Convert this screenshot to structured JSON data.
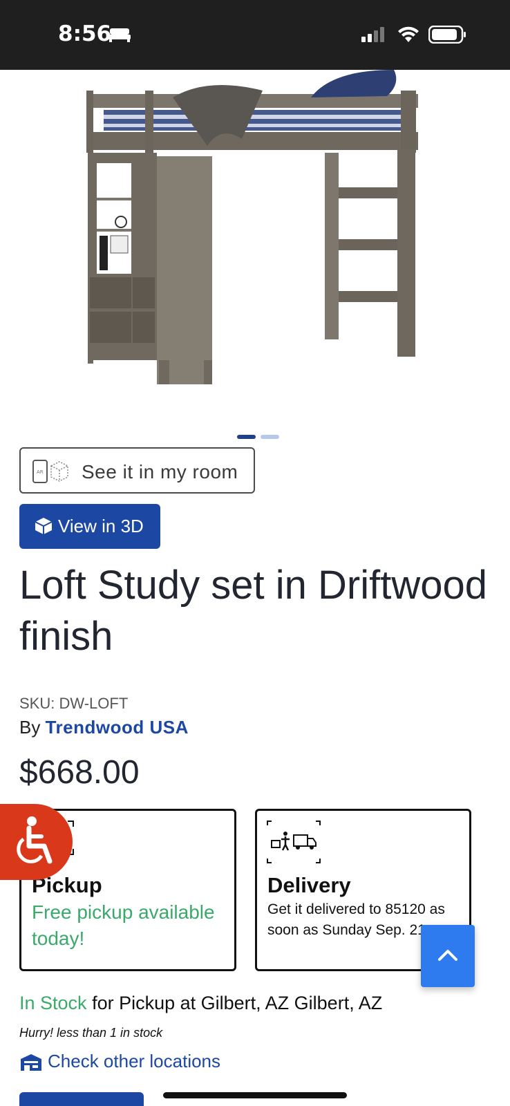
{
  "status_bar": {
    "time": "8:56",
    "icons": [
      "bed-icon",
      "signal-icon",
      "wifi-icon",
      "battery-icon"
    ]
  },
  "product": {
    "image_alt": "Loft bed with storage cabinet in driftwood finish",
    "carousel": {
      "total": 2,
      "active": 1
    },
    "ar_button_label": "See it in my room",
    "view3d_label": "View in 3D",
    "title": "Loft Study set in Driftwood finish",
    "sku_label": "SKU: DW-LOFT",
    "by_label": "By",
    "brand": "Trendwood USA",
    "price": "$668.00"
  },
  "fulfillment": {
    "pickup": {
      "title": "Pickup",
      "text": "Free pickup available today!",
      "icon": "store-pickup-icon"
    },
    "delivery": {
      "title": "Delivery",
      "text": "Get it delivered to 85120 as soon as Sunday Sep. 21",
      "icon": "delivery-truck-icon"
    }
  },
  "stock": {
    "status": "In Stock",
    "rest": "for Pickup at Gilbert, AZ Gilbert, AZ",
    "hurry": "Hurry! less than 1 in stock",
    "check_label": "Check other locations"
  },
  "colors": {
    "brand_blue": "#1c48a3",
    "stock_green": "#3aaa6a",
    "accessibility_red": "#d9391a",
    "scroll_button_blue": "#2d7bef"
  }
}
